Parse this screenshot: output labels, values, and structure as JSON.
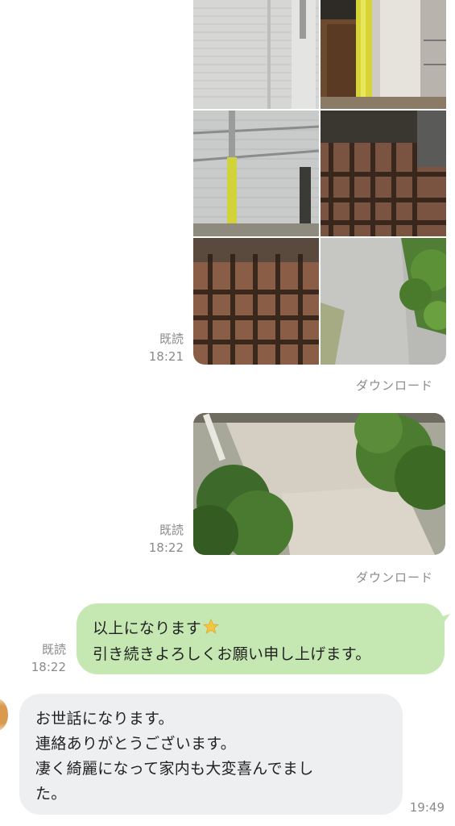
{
  "messages": {
    "photo_grid": {
      "read_label": "既読",
      "time": "18:21",
      "download_label": "ダウンロード"
    },
    "single_photo": {
      "read_label": "既読",
      "time": "18:22",
      "download_label": "ダウンロード"
    },
    "sent_text": {
      "line1": "以上になります",
      "line2": "引き続きよろしくお願い申し上げます。",
      "emoji_icon": "star-icon",
      "read_label": "既読",
      "time": "18:22"
    },
    "received_text": {
      "line1": "お世話になります。",
      "line2": "連絡ありがとうございます。",
      "line3": "凄く綺麗になって家内も大変喜んでまし",
      "line4": "た。",
      "time": "19:49"
    }
  },
  "colors": {
    "sent_bubble": "#c5e8b3",
    "received_bubble": "#eeeff1",
    "meta_text": "#8a8a8a"
  }
}
